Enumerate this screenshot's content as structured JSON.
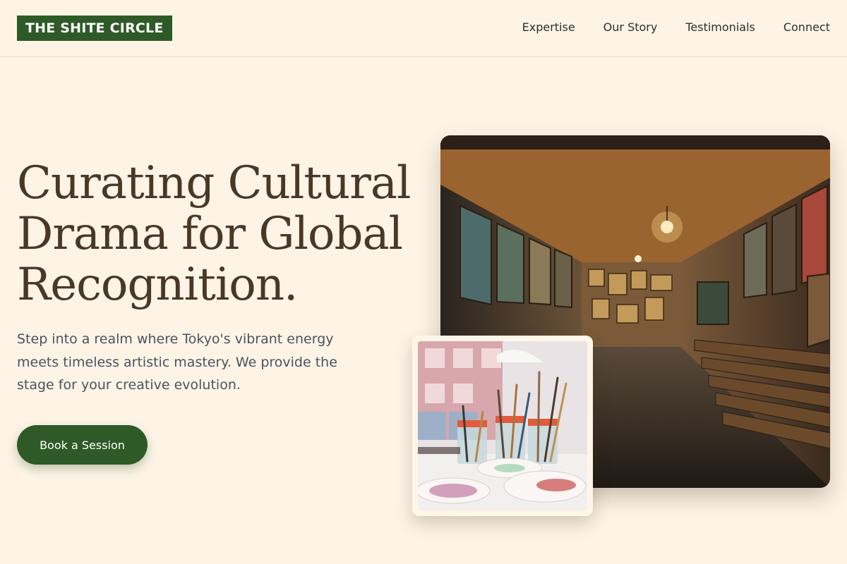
{
  "brand": {
    "name": "THE SHITE CIRCLE"
  },
  "nav": {
    "items": [
      {
        "label": "Expertise"
      },
      {
        "label": "Our Story"
      },
      {
        "label": "Testimonials"
      },
      {
        "label": "Connect"
      }
    ]
  },
  "hero": {
    "title": "Curating Cultural Drama for Global Recognition.",
    "description": "Step into a realm where Tokyo's vibrant energy meets timeless artistic mastery. We provide the stage for your creative evolution.",
    "cta_label": "Book a Session"
  },
  "images": {
    "main": "gallery-corridor-photo",
    "inset": "paint-brushes-jars-photo"
  },
  "colors": {
    "background": "#fdf4e6",
    "brand_green": "#2e5a27",
    "heading_brown": "#4a3826",
    "body_text": "#4a5260"
  }
}
